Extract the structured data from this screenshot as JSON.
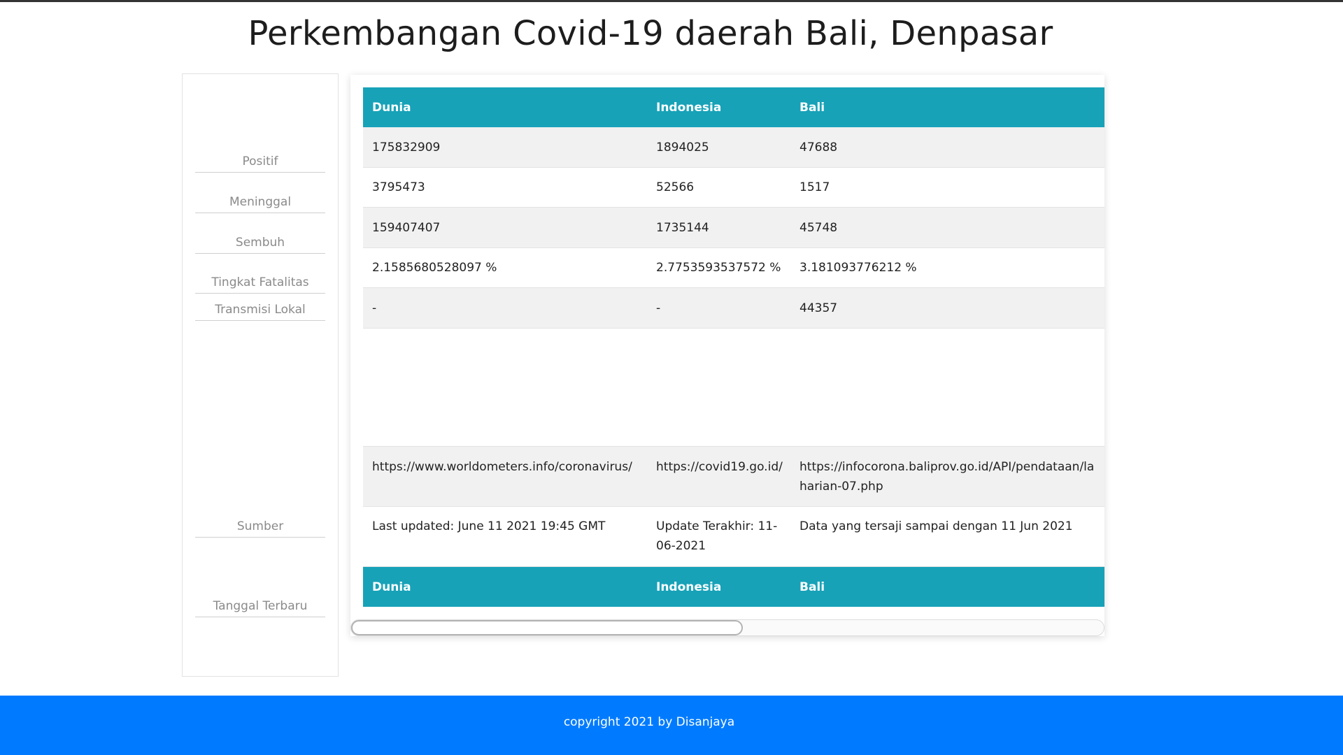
{
  "page_title": "Perkembangan Covid-19 daerah Bali, Denpasar",
  "sidebar": {
    "labels": [
      "Positif",
      "Meninggal",
      "Sembuh",
      "Tingkat Fatalitas",
      "Transmisi Lokal",
      "Sumber",
      "Tanggal Terbaru"
    ]
  },
  "table": {
    "header": [
      "Dunia",
      "Indonesia",
      "Bali"
    ],
    "rows": [
      [
        "175832909",
        "1894025",
        "47688"
      ],
      [
        "3795473",
        "52566",
        "1517"
      ],
      [
        "159407407",
        "1735144",
        "45748"
      ],
      [
        "2.1585680528097 %",
        "2.7753593537572 %",
        "3.181093776212 %"
      ],
      [
        "-",
        "-",
        "44357"
      ]
    ],
    "sources": [
      "https://www.worldometers.info/coronavirus/",
      "https://covid19.go.id/",
      "https://infocorona.baliprov.go.id/API/pendataan/laharian-07.php"
    ],
    "sources_c3_line1": "https://infocorona.baliprov.go.id/API/pendataan/la",
    "sources_c3_line2": "harian-07.php",
    "updated": [
      "Last updated: June 11 2021 19:45 GMT",
      "Update Terakhir: 11-06-2021",
      "Data yang tersaji sampai dengan 11 Jun 2021"
    ],
    "updated_c2_line1": "Update Terakhir: 11-",
    "updated_c2_line2": "06-2021",
    "footer_header": [
      "Dunia",
      "Indonesia",
      "Bali"
    ]
  },
  "scrollbar": {
    "position_fraction": 0,
    "visible_fraction": 0.52
  },
  "footer": {
    "text": "copyright 2021 by Disanjaya"
  },
  "colors": {
    "table_header": "#17a2b8",
    "footer": "#007bff",
    "row_alt": "#f1f1f1"
  }
}
